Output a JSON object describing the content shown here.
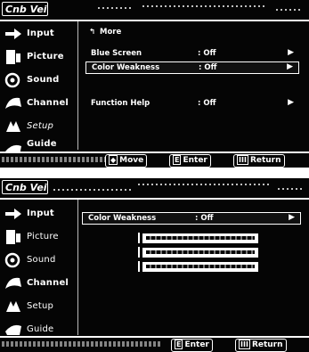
{
  "panel1": {
    "brand": "Cnb Vein",
    "sidebar": [
      {
        "icon": "input-icon",
        "label": "Input"
      },
      {
        "icon": "picture-icon",
        "label": "Picture"
      },
      {
        "icon": "sound-icon",
        "label": "Sound"
      },
      {
        "icon": "channel-icon",
        "label": "Channel"
      },
      {
        "icon": "setup-icon",
        "label": "Setup"
      },
      {
        "icon": "guide-icon",
        "label": "Guide"
      }
    ],
    "back_label": "More",
    "rows": [
      {
        "label": "Blue Screen",
        "value": ": Off",
        "arrow": "▶"
      },
      {
        "label": "Color Weakness",
        "value": ": Off",
        "arrow": "▶",
        "selected": true
      },
      {
        "label": "Function Help",
        "value": ": Off",
        "arrow": "▶"
      }
    ],
    "footer": {
      "move": "Move",
      "enter": "Enter",
      "return": "Return",
      "move_key": "◆",
      "enter_key": "E",
      "return_key": "III"
    }
  },
  "panel2": {
    "brand": "Cnb Vein",
    "sidebar": [
      {
        "icon": "input-icon",
        "label": "Input"
      },
      {
        "icon": "picture-icon",
        "label": "Picture"
      },
      {
        "icon": "sound-icon",
        "label": "Sound"
      },
      {
        "icon": "channel-icon",
        "label": "Channel"
      },
      {
        "icon": "setup-icon",
        "label": "Setup"
      },
      {
        "icon": "guide-icon",
        "label": "Guide"
      }
    ],
    "row": {
      "label": "Color Weakness",
      "value": ": Off",
      "arrow": "▶"
    },
    "footer": {
      "enter": "Enter",
      "return": "Return",
      "enter_key": "E",
      "return_key": "III"
    }
  }
}
